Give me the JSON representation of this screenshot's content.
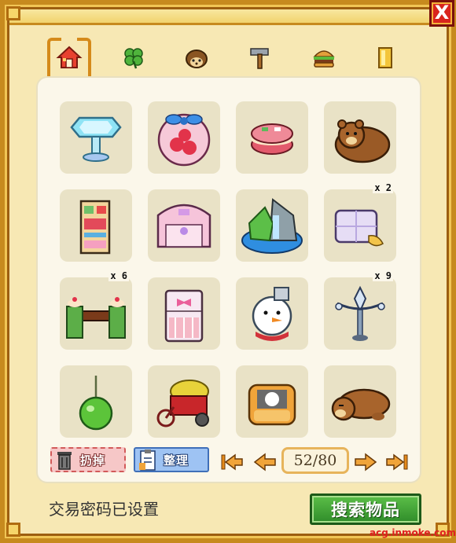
{
  "window": {
    "close_label": "X"
  },
  "tabs": [
    {
      "id": "home",
      "icon": "house-icon",
      "active": true
    },
    {
      "id": "plants",
      "icon": "clover-icon",
      "active": false
    },
    {
      "id": "animals",
      "icon": "hedgehog-icon",
      "active": false
    },
    {
      "id": "tools",
      "icon": "hammer-icon",
      "active": false
    },
    {
      "id": "food",
      "icon": "burger-icon",
      "active": false
    },
    {
      "id": "misc",
      "icon": "gold-bars-icon",
      "active": false
    }
  ],
  "items": [
    {
      "name": "crystal-pedestal",
      "qty": ""
    },
    {
      "name": "ribbon-gift-jar",
      "qty": ""
    },
    {
      "name": "macaron",
      "qty": ""
    },
    {
      "name": "brown-bear-plush",
      "qty": ""
    },
    {
      "name": "decorated-cabinet",
      "qty": ""
    },
    {
      "name": "pink-canopy-bed",
      "qty": ""
    },
    {
      "name": "waterfall-rock",
      "qty": ""
    },
    {
      "name": "lavender-pillow",
      "qty": "x 2"
    },
    {
      "name": "cake-hedge-fence",
      "qty": "x 6"
    },
    {
      "name": "ribbon-headboard",
      "qty": ""
    },
    {
      "name": "snowman",
      "qty": ""
    },
    {
      "name": "lamp-post",
      "qty": "x 9"
    },
    {
      "name": "green-apple",
      "qty": ""
    },
    {
      "name": "flower-cart",
      "qty": ""
    },
    {
      "name": "armchair-cat",
      "qty": ""
    },
    {
      "name": "sleeping-bear",
      "qty": ""
    }
  ],
  "toolbar": {
    "discard_label": "扔掉",
    "sort_label": "整理"
  },
  "pager": {
    "current": 52,
    "total": 80,
    "display": "52/80"
  },
  "footer": {
    "status": "交易密码已设置",
    "search_label": "搜索物品",
    "watermark": "acg.inmoke.com"
  },
  "colors": {
    "frame_gold": "#c78a1e",
    "panel_bg": "#fbf7ea",
    "slot_bg": "#e9e2c6",
    "close_red": "#d9251d",
    "search_green": "#2f8c2a"
  }
}
